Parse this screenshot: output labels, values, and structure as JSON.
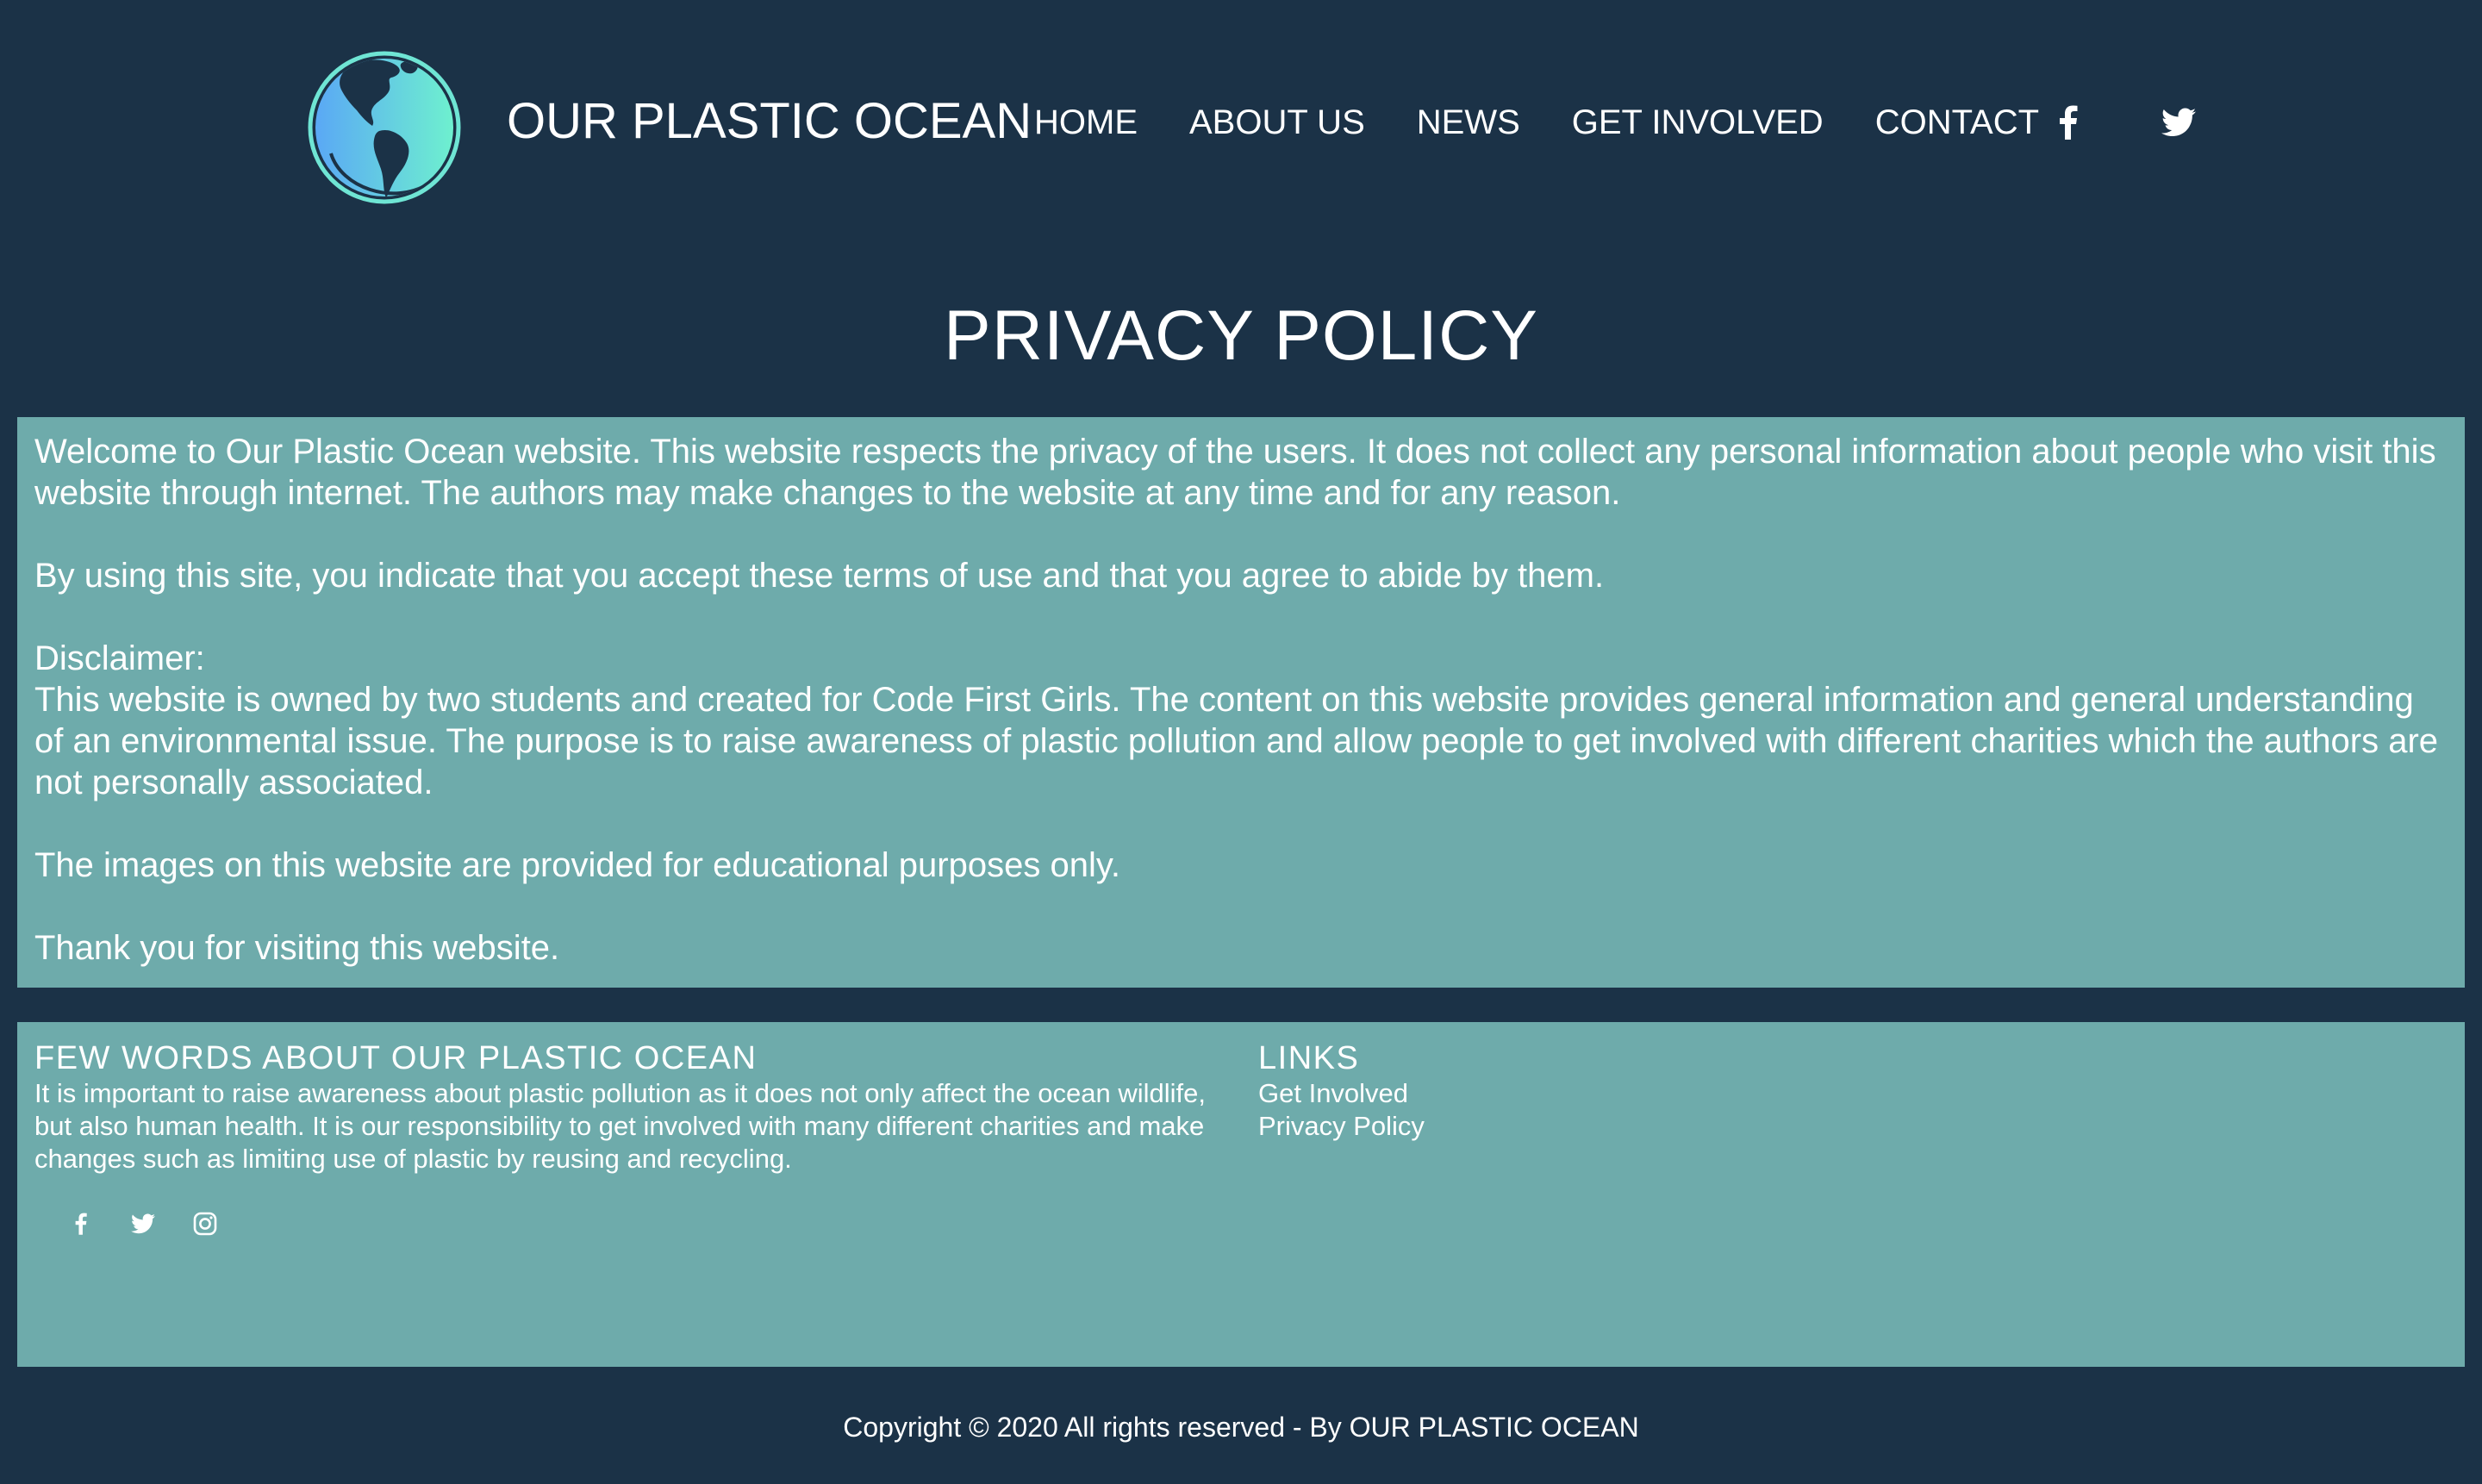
{
  "header": {
    "logo_icon": "globe-icon",
    "title": "OUR PLASTIC OCEAN",
    "nav": [
      {
        "label": "HOME"
      },
      {
        "label": "ABOUT US"
      },
      {
        "label": "NEWS"
      },
      {
        "label": "GET INVOLVED"
      },
      {
        "label": "CONTACT"
      }
    ],
    "social": [
      {
        "icon": "facebook-icon"
      },
      {
        "icon": "twitter-icon"
      }
    ]
  },
  "page": {
    "heading": "PRIVACY POLICY"
  },
  "policy": {
    "p1": "Welcome to Our Plastic Ocean website. This website respects the privacy of the users. It does not collect any personal information about people who visit this website through internet. The authors may make changes to the website at any time and for any reason.",
    "p2": "By using this site, you indicate that you accept these terms of use and that you agree to abide by them.",
    "p3_title": "Disclaimer:",
    "p3_text": "This website is owned by two students and created for Code First Girls. The content on this website provides general information and general understanding of an environmental issue. The purpose is to raise awareness of plastic pollution and allow people to get involved with different charities which the authors are not personally associated.",
    "p4": "The images on this website are provided for educational purposes only.",
    "p5": "Thank you for visiting this website."
  },
  "footer": {
    "about_heading": "FEW WORDS ABOUT OUR PLASTIC OCEAN",
    "about_text": "It is important to raise awareness about plastic pollution as it does not only affect the ocean wildlife, but also human health. It is our responsibility to get involved with many different charities and make changes such as limiting use of plastic by reusing and recycling.",
    "links_heading": "LINKS",
    "links": [
      {
        "label": "Get Involved"
      },
      {
        "label": "Privacy Policy"
      }
    ],
    "social": [
      {
        "icon": "facebook-icon"
      },
      {
        "icon": "twitter-icon"
      },
      {
        "icon": "instagram-icon"
      }
    ],
    "copyright": "Copyright © 2020 All rights reserved - By OUR PLASTIC OCEAN"
  },
  "colors": {
    "background": "#1b3247",
    "panel": "#6eabab",
    "text": "#ffffff",
    "logo_gradient_start": "#5aa8f5",
    "logo_gradient_end": "#6ef0cf"
  }
}
